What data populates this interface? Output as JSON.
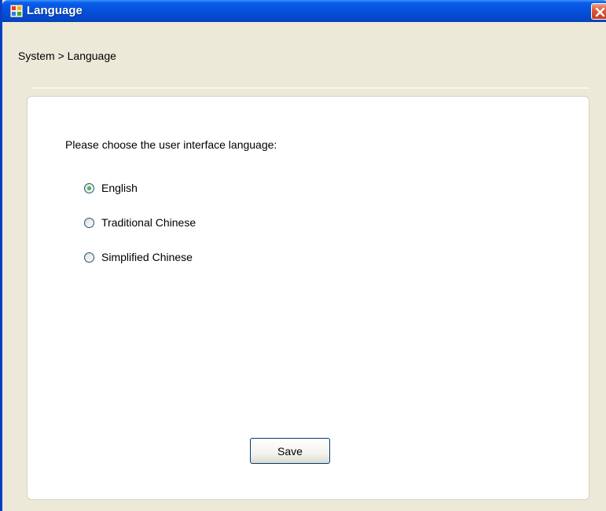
{
  "window": {
    "title": "Language",
    "icons": {
      "app": "app-window-icon",
      "close": "close-icon"
    }
  },
  "breadcrumb": "System > Language",
  "main": {
    "prompt": "Please choose the user interface language:",
    "options": [
      {
        "label": "English",
        "checked": true
      },
      {
        "label": "Traditional Chinese",
        "checked": false
      },
      {
        "label": "Simplified Chinese",
        "checked": false
      }
    ],
    "save_label": "Save"
  },
  "colors": {
    "titlebar": "#0550dc",
    "close_button": "#dc5b3d",
    "window_bg": "#ece9d8",
    "panel_bg": "#ffffff",
    "radio_selected": "#21a121"
  }
}
